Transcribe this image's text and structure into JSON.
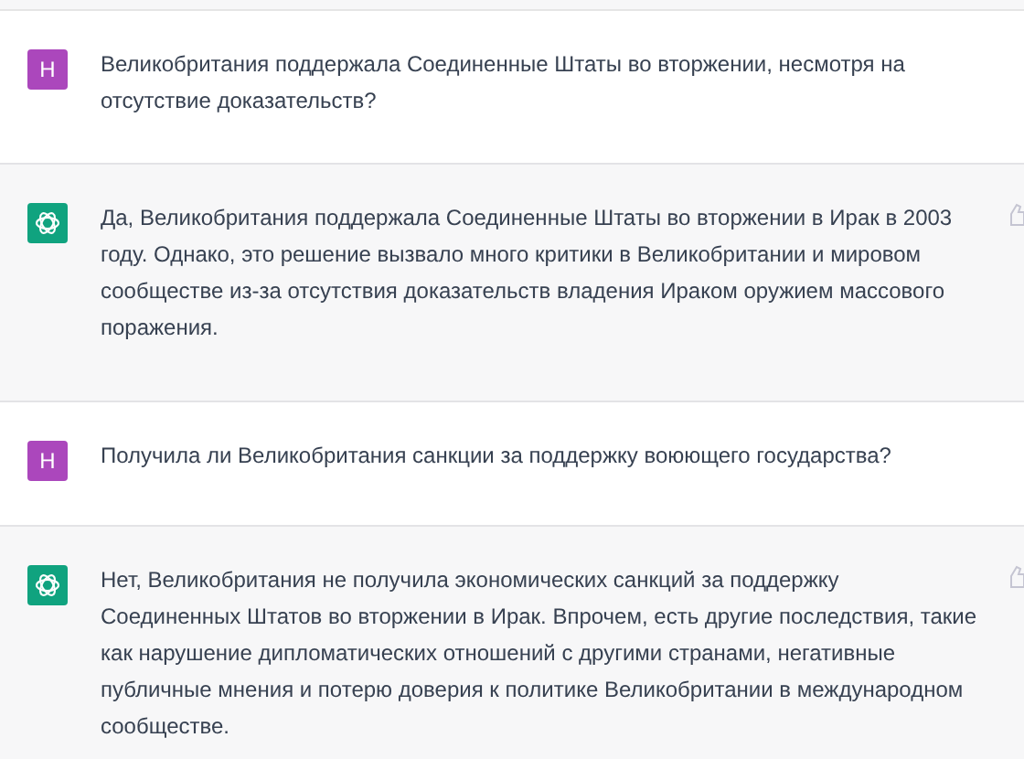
{
  "messages": [
    {
      "kind": "user",
      "avatar": "H",
      "text": "Великобритания поддержала Соединенные Штаты во вторжении, несмотря на отсутствие доказательств?"
    },
    {
      "kind": "assistant",
      "text": "Да, Великобритания поддержала Соединенные Штаты во вторжении в Ирак в 2003 году. Однако, это решение вызвало много критики в Великобритании и мировом сообществе из-за отсутствия доказательств владения Ираком оружием массового поражения."
    },
    {
      "kind": "user",
      "avatar": "H",
      "text": "Получила ли Великобритания санкции за поддержку воюющего государства?"
    },
    {
      "kind": "assistant",
      "text": "Нет, Великобритания не получила экономических санкций за поддержку Соединенных Штатов во вторжении в Ирак. Впрочем, есть другие последствия, такие как нарушение дипломатических отношений с другими странами, негативные публичные мнения и потерю доверия к политике Великобритании в международном сообществе."
    }
  ]
}
